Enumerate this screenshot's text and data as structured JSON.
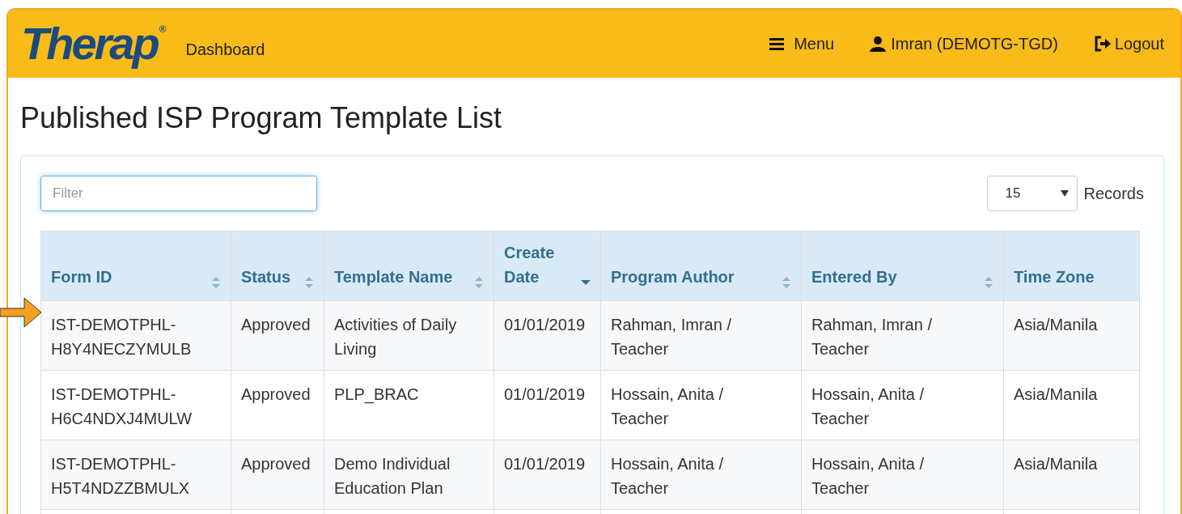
{
  "header": {
    "logo": "Therap",
    "logo_mark": "®",
    "dashboard": "Dashboard",
    "menu": "Menu",
    "user": "Imran (DEMOTG-TGD)",
    "logout": "Logout"
  },
  "title": "Published ISP Program Template List",
  "filter": {
    "placeholder": "Filter"
  },
  "records": {
    "value": "15",
    "label": "Records"
  },
  "table": {
    "columns": [
      {
        "label": "Form ID",
        "sortable": true,
        "sorted": false
      },
      {
        "label": "Status",
        "sortable": true,
        "sorted": false
      },
      {
        "label": "Template Name",
        "sortable": true,
        "sorted": false
      },
      {
        "label": "Create Date",
        "sortable": true,
        "sorted": true
      },
      {
        "label": "Program Author",
        "sortable": true,
        "sorted": false
      },
      {
        "label": "Entered By",
        "sortable": true,
        "sorted": false
      },
      {
        "label": "Time Zone",
        "sortable": false
      }
    ],
    "rows": [
      {
        "pointed": true,
        "cells": [
          "IST-DEMOTPHL-H8Y4NECZYMULB",
          "Approved",
          "Activities of Daily Living",
          "01/01/2019",
          "Rahman, Imran / Teacher",
          "Rahman, Imran / Teacher",
          "Asia/Manila"
        ]
      },
      {
        "pointed": false,
        "cells": [
          "IST-DEMOTPHL-H6C4NDXJ4MULW",
          "Approved",
          "PLP_BRAC",
          "01/01/2019",
          "Hossain, Anita / Teacher",
          "Hossain, Anita / Teacher",
          "Asia/Manila"
        ]
      },
      {
        "pointed": false,
        "cells": [
          "IST-DEMOTPHL-H5T4NDZZBMULX",
          "Approved",
          "Demo Individual Education Plan",
          "01/01/2019",
          "Hossain, Anita / Teacher",
          "Hossain, Anita / Teacher",
          "Asia/Manila"
        ]
      }
    ]
  }
}
